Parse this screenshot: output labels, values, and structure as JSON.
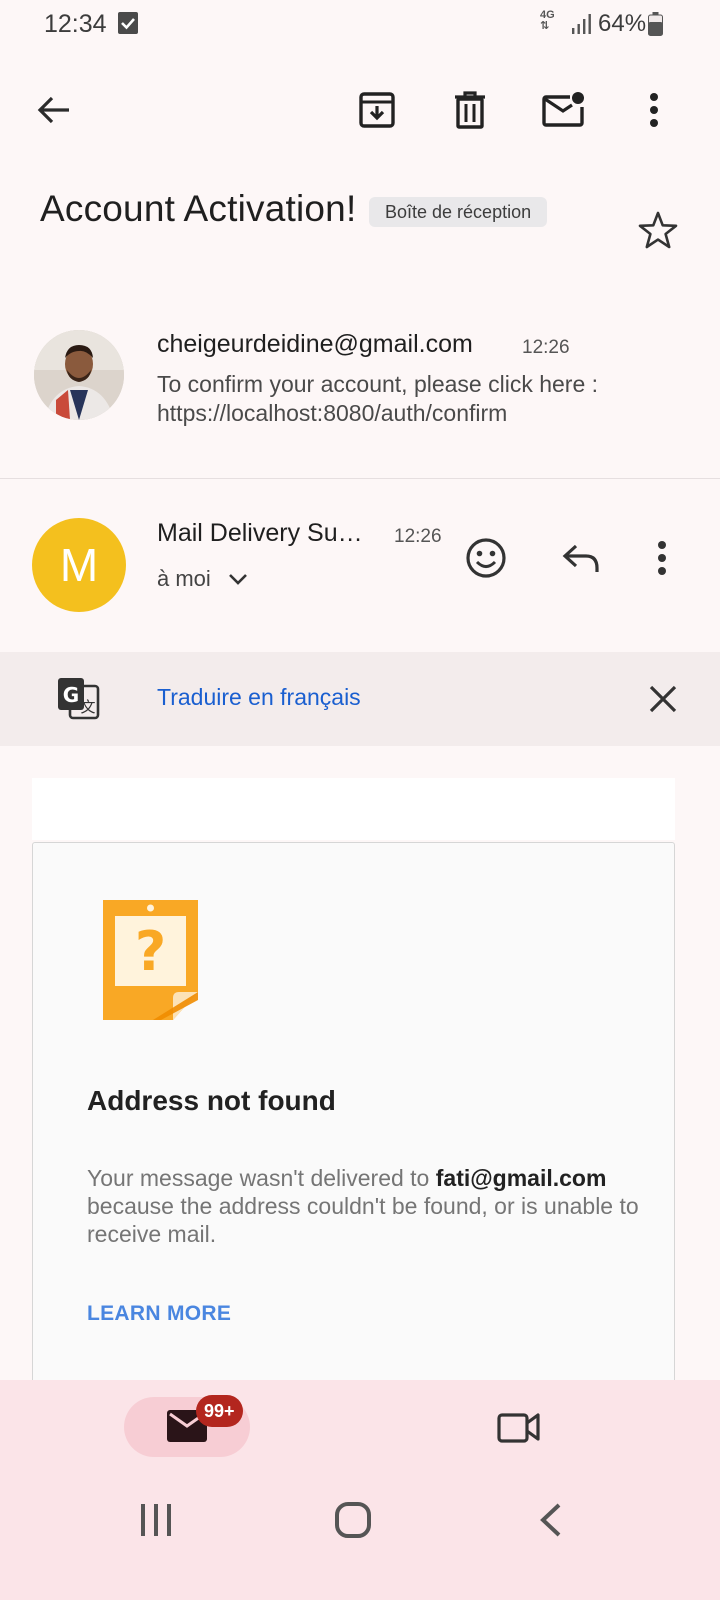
{
  "status_bar": {
    "time": "12:34",
    "network": "4G",
    "battery": "64%",
    "icons": [
      "checkbox-notification-icon",
      "signal-icon",
      "battery-icon"
    ]
  },
  "toolbar": {
    "icons": [
      "back-arrow-icon",
      "archive-icon",
      "delete-icon",
      "mark-unread-icon",
      "more-vert-icon"
    ]
  },
  "email": {
    "subject": "Account Activation!",
    "label": "Boîte de réception"
  },
  "message1": {
    "sender": "cheigeurdeidine@gmail.com",
    "time": "12:26",
    "snippet": "To confirm your account, please click here : https://localhost:8080/auth/confirm"
  },
  "message2": {
    "avatar_letter": "M",
    "sender": "Mail Delivery Su…",
    "time": "12:26",
    "to": "à moi",
    "actions": [
      "emoji-react-icon",
      "reply-icon",
      "more-vert-icon"
    ]
  },
  "translate": {
    "link": "Traduire en français"
  },
  "ndr": {
    "title": "Address not found",
    "text_prefix": "Your message wasn't delivered to ",
    "address": "fati@gmail.com",
    "text_suffix": " because the address couldn't be found, or is unable to receive mail.",
    "learn_more": "LEARN MORE"
  },
  "bottom_nav": {
    "mail_badge": "99+",
    "items": [
      "mail-icon",
      "video-meet-icon"
    ]
  },
  "colors": {
    "accent_link": "#1a5fd0",
    "avatar_m": "#f4c01e",
    "badge": "#b3261e",
    "ndr_icon": "#f9a825"
  }
}
